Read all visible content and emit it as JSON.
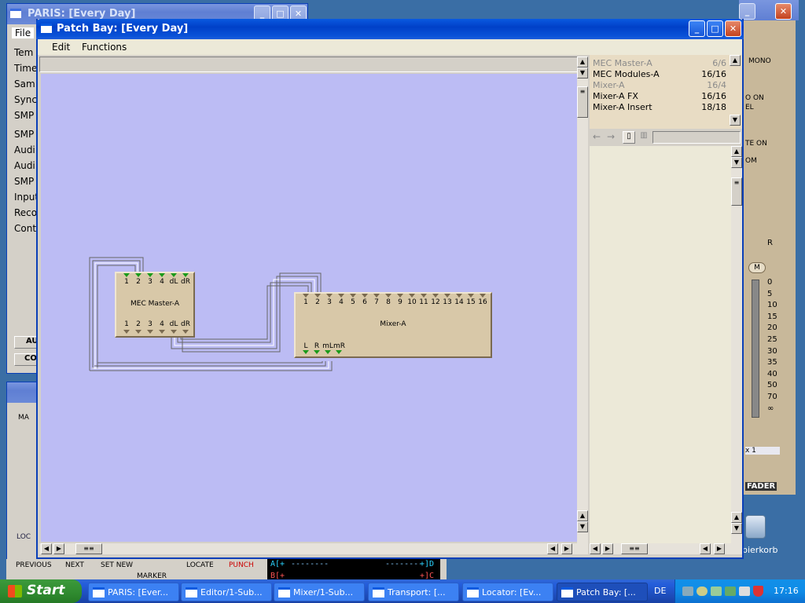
{
  "desktop": {
    "paris_window": {
      "title": "PARIS: [Every Day]",
      "menu_file": "File",
      "side_items": [
        "Tem",
        "Time",
        "Sam",
        "Sync",
        "SMP",
        "SMP",
        "Audi",
        "Audi",
        "SMP",
        "Input",
        "Reco",
        "Cont"
      ],
      "bottom_buttons": [
        "AU",
        "CO"
      ]
    },
    "right_panel": {
      "mono": "MONO",
      "solo_on": "O ON",
      "el": "EL",
      "mute_on": "TE ON",
      "om": "OM",
      "r": "R",
      "m": "M",
      "scale": [
        "0",
        "5",
        "10",
        "15",
        "20",
        "25",
        "30",
        "35",
        "40",
        "50",
        "70",
        "∞"
      ],
      "x1": "x 1",
      "fader": "FADER",
      "recycle": "pierkorb"
    },
    "transport": {
      "previous": "PREVIOUS",
      "next": "NEXT",
      "set_new": "SET NEW",
      "marker": "MARKER",
      "locate": "LOCATE",
      "punch": "PUNCH",
      "loc": "LOC",
      "display_a_left": "A[+",
      "display_a_dash": "--------",
      "display_a_right": "+]D",
      "display_b_left": "B[+",
      "display_b_right": "+]C",
      "ma": "MA"
    }
  },
  "patch_bay": {
    "title": "Patch Bay: [Every Day]",
    "menu": {
      "edit": "Edit",
      "functions": "Functions"
    },
    "modules": {
      "mec_master": {
        "label": "MEC Master-A",
        "ports": [
          "1",
          "2",
          "3",
          "4",
          "dL",
          "dR"
        ]
      },
      "mixer": {
        "label": "Mixer-A",
        "ports": [
          "1",
          "2",
          "3",
          "4",
          "5",
          "6",
          "7",
          "8",
          "9",
          "10",
          "11",
          "12",
          "13",
          "14",
          "15",
          "16"
        ],
        "bottom_ports": [
          "L",
          "R",
          "mL",
          "mR"
        ]
      }
    },
    "list": [
      {
        "name": "MEC Master-A",
        "count": "6/6",
        "dim": true
      },
      {
        "name": "MEC Modules-A",
        "count": "16/16",
        "dim": false
      },
      {
        "name": "Mixer-A",
        "count": "16/4",
        "dim": true
      },
      {
        "name": "Mixer-A FX",
        "count": "16/16",
        "dim": false
      },
      {
        "name": "Mixer-A Insert",
        "count": "18/18",
        "dim": false
      }
    ]
  },
  "taskbar": {
    "start": "Start",
    "tasks": [
      "PARIS: [Ever...",
      "Editor/1-Sub...",
      "Mixer/1-Sub...",
      "Transport: [...",
      "Locator: [Ev...",
      "Patch Bay: [..."
    ],
    "lang": "DE",
    "clock": "17:16"
  },
  "colors": {
    "canvas": "#bcbcf4",
    "module": "#d8c8a8",
    "port_green": "#1a9a1a"
  }
}
